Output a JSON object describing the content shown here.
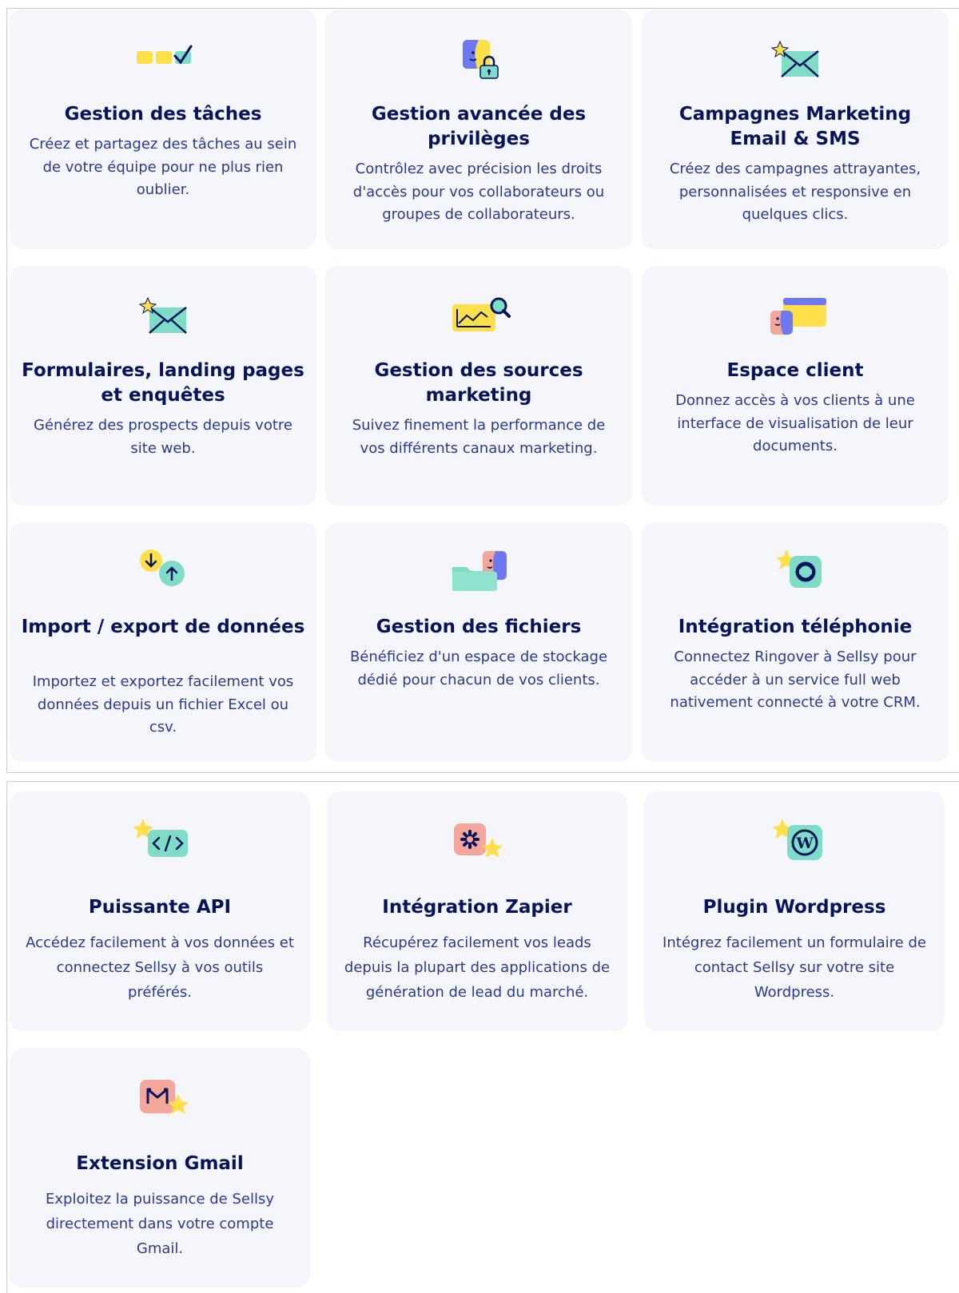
{
  "cards": [
    {
      "title": "Gestion des tâches",
      "description": "Créez et partagez des tâches au sein de votre équipe pour ne plus rien oublier.",
      "icon": "tasks-checkbox-icon"
    },
    {
      "title": "Gestion avancée des privilèges",
      "description": "Contrôlez avec précision les droits d'accès pour vos collaborateurs ou groupes de collaborateurs.",
      "icon": "privileges-lock-icon"
    },
    {
      "title": "Campagnes Marketing Email & SMS",
      "description": "Créez des campagnes attrayantes, personnalisées et responsive en quelques clics.",
      "icon": "envelope-spark-icon"
    },
    {
      "title": "Formulaires, landing pages et enquêtes",
      "description": "Générez des prospects depuis votre site web.",
      "icon": "envelope-spark-icon"
    },
    {
      "title": "Gestion des sources marketing",
      "description": "Suivez finement la performance de vos différents canaux marketing.",
      "icon": "chart-magnifier-icon"
    },
    {
      "title": "Espace client",
      "description": "Donnez accès à vos clients à une interface de visualisation de leur documents.",
      "icon": "client-card-icon"
    },
    {
      "title": "Import / export de données",
      "description": "Importez et exportez facilement vos données depuis un fichier Excel ou csv.",
      "icon": "import-export-arrows-icon"
    },
    {
      "title": "Gestion des fichiers",
      "description": "Bénéficiez d'un espace de stockage dédié pour chacun de vos clients.",
      "icon": "folder-face-icon"
    },
    {
      "title": "Intégration téléphonie",
      "description": "Connectez Ringover à Sellsy pour accéder à un service full web nativement connecté à votre CRM.",
      "icon": "ringover-logo-icon"
    }
  ],
  "integrations": [
    {
      "title": "Puissante API",
      "description": "Accédez facilement à vos données et connectez Sellsy à vos outils préférés.",
      "icon": "code-brackets-icon"
    },
    {
      "title": "Intégration Zapier",
      "description": "Récupérez facilement vos leads depuis la plupart des applications de génération de lead du marché.",
      "icon": "zapier-logo-icon"
    },
    {
      "title": "Plugin Wordpress",
      "description": "Intégrez facilement un formulaire de contact Sellsy sur votre site Wordpress.",
      "icon": "wordpress-logo-icon"
    },
    {
      "title": "Extension Gmail",
      "description": "Exploitez la puissance de Sellsy directement dans votre compte Gmail.",
      "icon": "gmail-logo-icon"
    }
  ],
  "colors": {
    "card_bg": "#f5f6fc",
    "title": "#06145c",
    "text": "#2b3a8c",
    "yellow": "#ffe04a",
    "teal": "#7fdcc6",
    "blue": "#6e78f0",
    "pink": "#f4a69b",
    "navy": "#06145c"
  }
}
